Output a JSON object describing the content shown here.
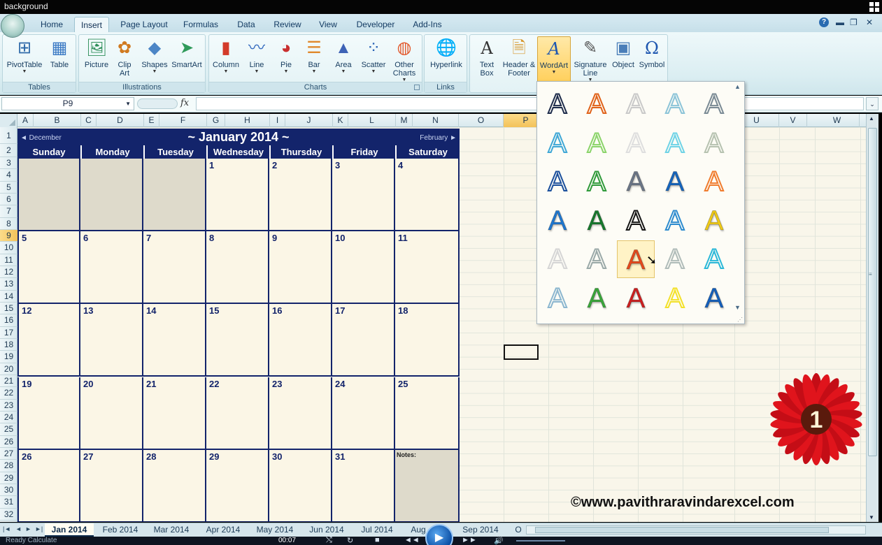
{
  "window": {
    "title": "background"
  },
  "ribbon": {
    "tabs": [
      "Home",
      "Insert",
      "Page Layout",
      "Formulas",
      "Data",
      "Review",
      "View",
      "Developer",
      "Add-Ins"
    ],
    "active_tab": "Insert",
    "groups": {
      "tables": {
        "label": "Tables",
        "buttons": [
          "PivotTable",
          "Table"
        ]
      },
      "illustrations": {
        "label": "Illustrations",
        "buttons": [
          "Picture",
          "Clip Art",
          "Shapes",
          "SmartArt"
        ]
      },
      "charts": {
        "label": "Charts",
        "buttons": [
          "Column",
          "Line",
          "Pie",
          "Bar",
          "Area",
          "Scatter",
          "Other Charts"
        ]
      },
      "links": {
        "label": "Links",
        "buttons": [
          "Hyperlink"
        ]
      },
      "text": {
        "buttons": [
          "Text Box",
          "Header & Footer",
          "WordArt",
          "Signature Line",
          "Object",
          "Symbol"
        ]
      }
    },
    "selected_button": "WordArt"
  },
  "formula_bar": {
    "name_box": "P9",
    "fx_label": "fx",
    "value": ""
  },
  "columns": [
    "A",
    "B",
    "C",
    "D",
    "E",
    "F",
    "G",
    "H",
    "I",
    "J",
    "K",
    "L",
    "M",
    "N",
    "O",
    "P",
    "U",
    "V",
    "W"
  ],
  "selected_column": "P",
  "rows": [
    "1",
    "2",
    "3",
    "4",
    "5",
    "6",
    "7",
    "8",
    "9",
    "10",
    "11",
    "12",
    "13",
    "14",
    "15",
    "16",
    "17",
    "18",
    "19",
    "20",
    "21",
    "22",
    "23",
    "24",
    "25",
    "26",
    "27",
    "28",
    "29",
    "30",
    "31",
    "32"
  ],
  "selected_row": "9",
  "calendar": {
    "prev_month": "◄ December",
    "title": "~ January 2014 ~",
    "next_month": "February ►",
    "weekdays": [
      "Sunday",
      "Monday",
      "Tuesday",
      "Wednesday",
      "Thursday",
      "Friday",
      "Saturday"
    ],
    "weeks": [
      [
        "",
        "",
        "",
        "1",
        "2",
        "3",
        "4"
      ],
      [
        "5",
        "6",
        "7",
        "8",
        "9",
        "10",
        "11"
      ],
      [
        "12",
        "13",
        "14",
        "15",
        "16",
        "17",
        "18"
      ],
      [
        "19",
        "20",
        "21",
        "22",
        "23",
        "24",
        "25"
      ],
      [
        "26",
        "27",
        "28",
        "29",
        "30",
        "31",
        "Notes:"
      ]
    ]
  },
  "wordart_gallery": {
    "styles": [
      {
        "color": "#1d2b4a",
        "style": "outline"
      },
      {
        "color": "#e0621a",
        "style": "outline"
      },
      {
        "color": "#c9c9c9",
        "style": "outline"
      },
      {
        "color": "#8cc4d8",
        "style": "outline"
      },
      {
        "color": "#7a8a94",
        "style": "outline"
      },
      {
        "color": "#3fa7d6",
        "style": "outline"
      },
      {
        "color": "#8bd46a",
        "style": "outline"
      },
      {
        "color": "#dedede",
        "style": "outline"
      },
      {
        "color": "#6fd3e6",
        "style": "outline"
      },
      {
        "color": "#b6c2b0",
        "style": "outline"
      },
      {
        "color": "#1b4f9c",
        "style": "outline"
      },
      {
        "color": "#2f9a3a",
        "style": "outline"
      },
      {
        "color": "#6c7788",
        "style": "fill"
      },
      {
        "color": "#1566c0",
        "style": "fill"
      },
      {
        "color": "#f07c2e",
        "style": "outline"
      },
      {
        "color": "#1f78d1",
        "style": "fill"
      },
      {
        "color": "#177a2d",
        "style": "fill"
      },
      {
        "color": "#151515",
        "style": "outline"
      },
      {
        "color": "#2e8ccf",
        "style": "outline"
      },
      {
        "color": "#f2cc16",
        "style": "fill"
      },
      {
        "color": "#d5d5d5",
        "style": "outline"
      },
      {
        "color": "#9aa9a8",
        "style": "outline"
      },
      {
        "color": "#e84a1c",
        "style": "fill"
      },
      {
        "color": "#b0bcb9",
        "style": "outline"
      },
      {
        "color": "#2bb8d8",
        "style": "outline"
      },
      {
        "color": "#8bb6cf",
        "style": "outline"
      },
      {
        "color": "#3aa83a",
        "style": "fill"
      },
      {
        "color": "#cf1f1f",
        "style": "fill"
      },
      {
        "color": "#f3e12a",
        "style": "outline"
      },
      {
        "color": "#1460bd",
        "style": "fill"
      }
    ],
    "hovered_index": 22
  },
  "sheet_tabs": [
    "Jan 2014",
    "Feb 2014",
    "Mar 2014",
    "Apr 2014",
    "May 2014",
    "Jun 2014",
    "Jul 2014",
    "Aug",
    "Sep 2014",
    "O"
  ],
  "active_sheet": "Jan 2014",
  "status": {
    "left": "Ready   Calculate"
  },
  "player": {
    "time": "00:07"
  },
  "overlay": {
    "badge_number": "1",
    "watermark": "©www.pavithraravindarexcel.com"
  },
  "colors": {
    "calendar_navy": "#13246b",
    "sheet_bg": "#f9f6ea",
    "ribbon_bg": "#e3f2f5"
  }
}
